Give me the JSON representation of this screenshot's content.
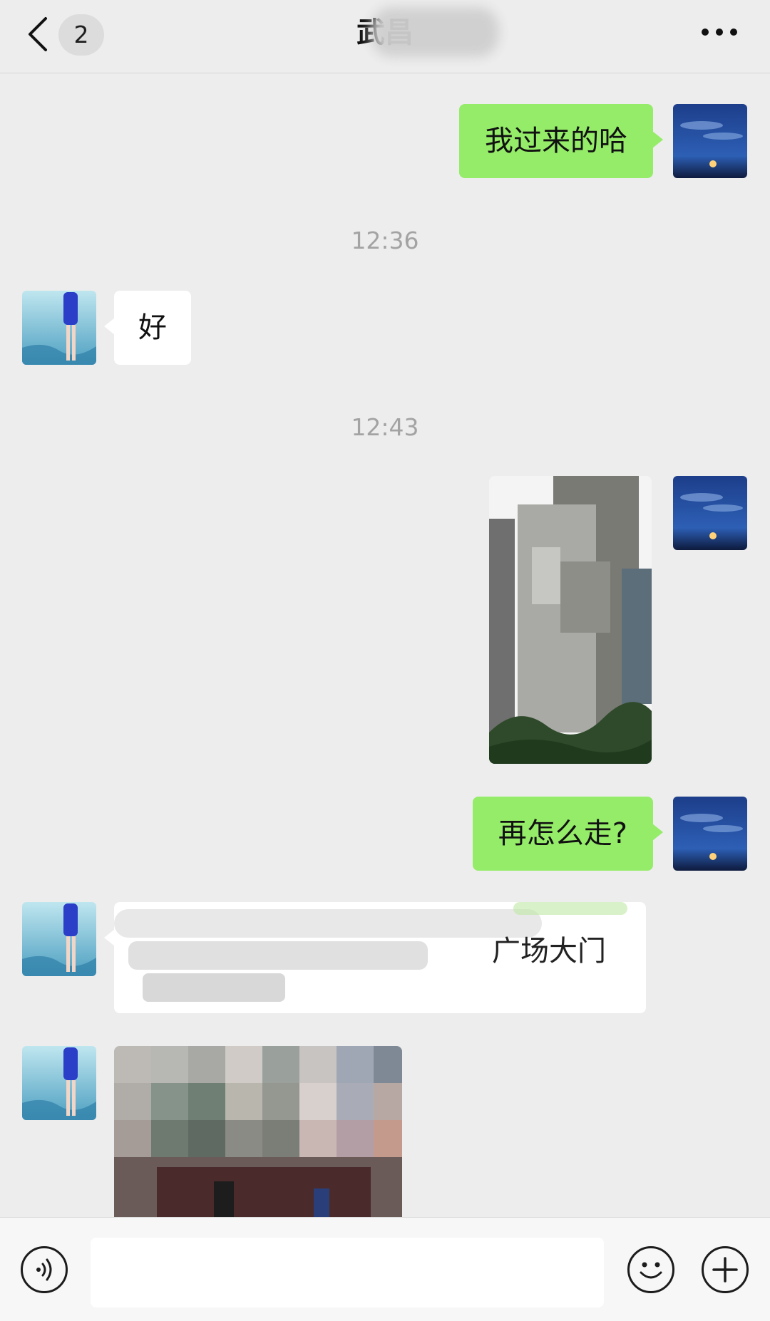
{
  "header": {
    "back_count": "2",
    "title": "武昌",
    "more_label": "•••"
  },
  "messages": [
    {
      "from": "self",
      "type": "text",
      "text": "我过来的哈"
    },
    {
      "type": "time",
      "text": "12:36"
    },
    {
      "from": "other",
      "type": "text",
      "text": "好"
    },
    {
      "type": "time",
      "text": "12:43"
    },
    {
      "from": "self",
      "type": "image",
      "description": "building-photo-redacted"
    },
    {
      "from": "self",
      "type": "text",
      "text": "再怎么走?"
    },
    {
      "from": "other",
      "type": "text-redacted",
      "visible_tail": "广场大门"
    },
    {
      "from": "other",
      "type": "image",
      "description": "street-photo-redacted"
    }
  ],
  "input_bar": {
    "placeholder": "",
    "voice_icon": "voice-icon",
    "emoji_icon": "emoji-icon",
    "add_icon": "plus-icon"
  },
  "colors": {
    "background": "#ededed",
    "self_bubble": "#95ec69",
    "other_bubble": "#ffffff",
    "timestamp": "#a3a3a3"
  }
}
